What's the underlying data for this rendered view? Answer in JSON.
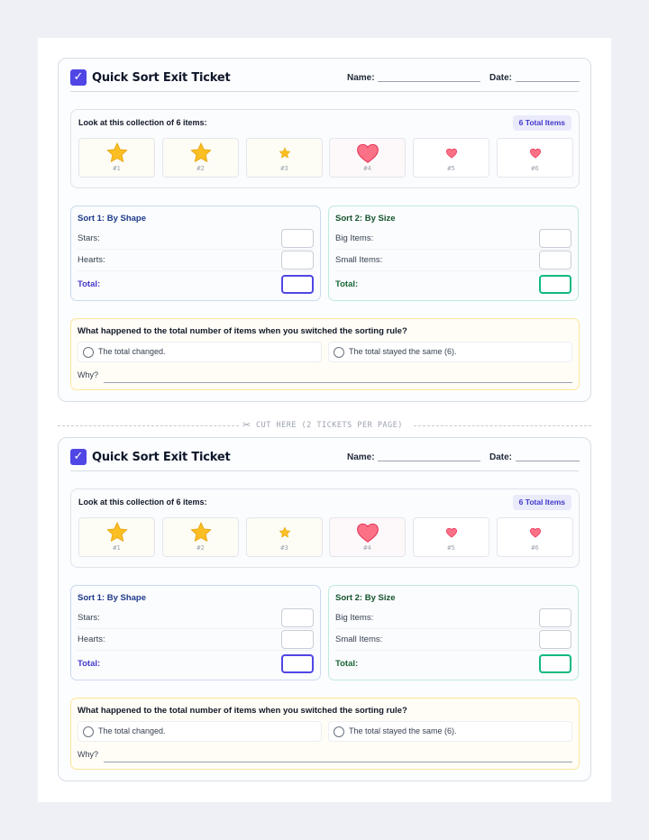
{
  "ticket": {
    "check_glyph": "✓",
    "title": "Quick Sort Exit Ticket",
    "name_label": "Name:",
    "date_label": "Date:",
    "collection_prompt": "Look at this collection of 6 items:",
    "badge": "6 Total Items",
    "items": [
      {
        "num": "#1",
        "icon": "star-big-icon"
      },
      {
        "num": "#2",
        "icon": "star-big-icon"
      },
      {
        "num": "#3",
        "icon": "star-small-icon"
      },
      {
        "num": "#4",
        "icon": "heart-big-icon"
      },
      {
        "num": "#5",
        "icon": "heart-small-icon"
      },
      {
        "num": "#6",
        "icon": "heart-small-icon"
      }
    ],
    "sort1": {
      "title": "Sort 1: By Shape",
      "row1": "Stars:",
      "row2": "Hearts:",
      "total": "Total:"
    },
    "sort2": {
      "title": "Sort 2: By Size",
      "row1": "Big Items:",
      "row2": "Small Items:",
      "total": "Total:"
    },
    "question": "What happened to the total number of items when you switched the sorting rule?",
    "option1": "The total changed.",
    "option2": "The total stayed the same (6).",
    "why_label": "Why?"
  },
  "cut": {
    "scissor": "✂",
    "text": "CUT HERE (2 TICKETS PER PAGE)"
  },
  "colors": {
    "accent": "#5046e5",
    "star": "#fbbf24",
    "heart": "#fb7185",
    "sort1_border": "#c9d9ee",
    "sort2_border": "#bfeadb",
    "question_border": "#fde59a"
  }
}
